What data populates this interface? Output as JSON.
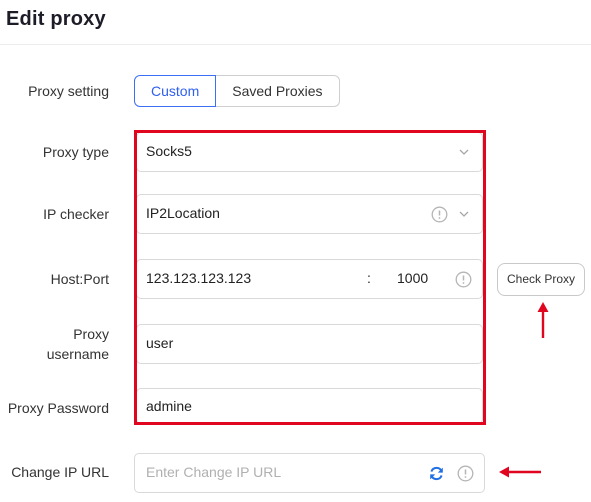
{
  "header": {
    "title": "Edit proxy"
  },
  "proxy_setting": {
    "label": "Proxy setting",
    "options": [
      "Custom",
      "Saved Proxies"
    ],
    "selected": "Custom"
  },
  "proxy_type": {
    "label": "Proxy type",
    "value": "Socks5"
  },
  "ip_checker": {
    "label": "IP checker",
    "value": "IP2Location"
  },
  "host_port": {
    "label": "Host:Port",
    "host": "123.123.123.123",
    "separator": ":",
    "port": "1000"
  },
  "check_proxy": {
    "label": "Check Proxy"
  },
  "proxy_username": {
    "label_line1": "Proxy",
    "label_line2": "username",
    "value": "user"
  },
  "proxy_password": {
    "label": "Proxy Password",
    "value": "admine"
  },
  "change_ip_url": {
    "label": "Change IP URL",
    "placeholder": "Enter Change IP URL"
  },
  "colors": {
    "accent": "#2f5ff0",
    "highlight": "#e0061f",
    "refresh": "#1f6fe5"
  },
  "icons": [
    "chevron-down-icon",
    "info-icon",
    "refresh-icon"
  ]
}
